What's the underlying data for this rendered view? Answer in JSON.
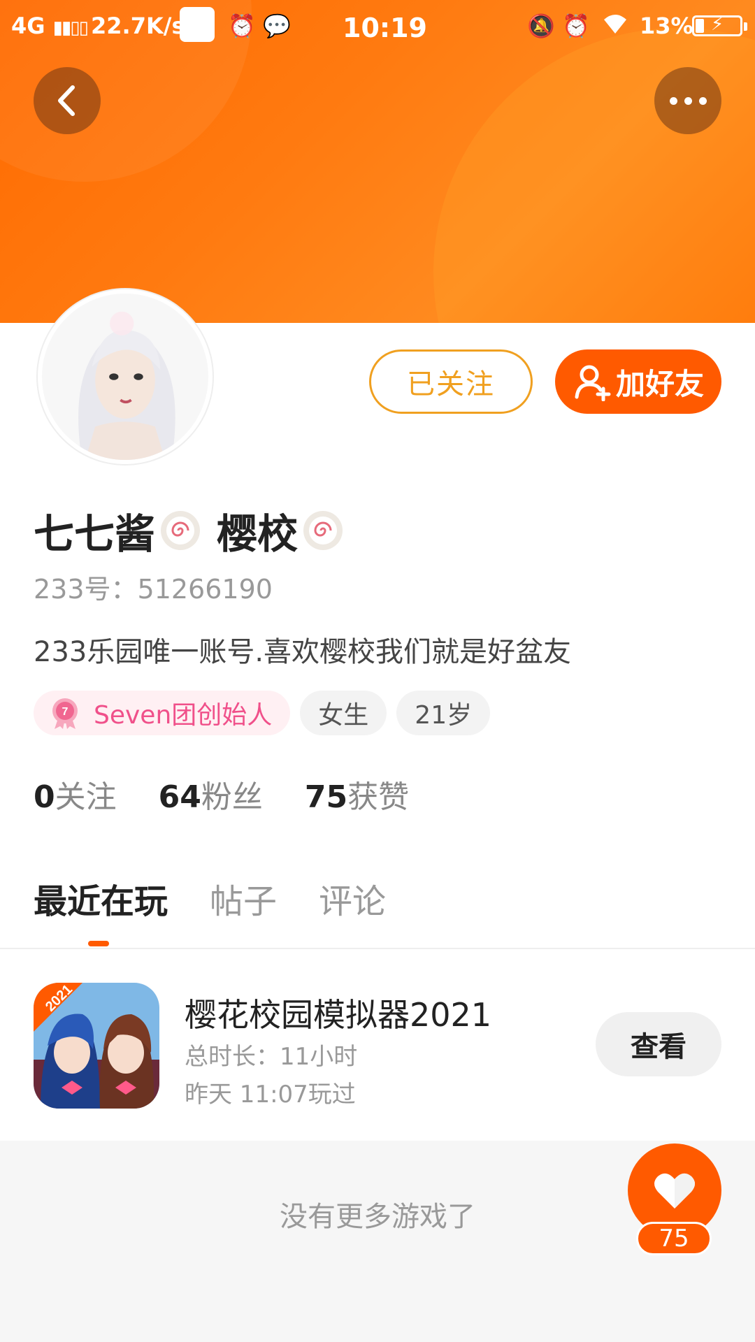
{
  "status_bar": {
    "network": "4G",
    "speed": "22.7K/s",
    "time": "10:19",
    "battery": "13%"
  },
  "header": {
    "back_icon": "chevron-left-icon",
    "more_icon": "more-dots-icon",
    "accent_color": "#ff6a00"
  },
  "profile": {
    "name_part1": "七七酱",
    "name_part2": "樱校",
    "user_id": "233号：51266190",
    "bio": "233乐园唯一账号.喜欢樱校我们就是好盆友",
    "followed_label": "已关注",
    "add_friend_label": "加好友",
    "tags": [
      {
        "label": "Seven团创始人",
        "badge": "7"
      },
      {
        "label": "女生"
      },
      {
        "label": "21岁"
      }
    ],
    "stats": {
      "following_num": "0",
      "following_label": "关注",
      "fans_num": "64",
      "fans_label": "粉丝",
      "likes_num": "75",
      "likes_label": "获赞"
    }
  },
  "tabs": [
    {
      "label": "最近在玩",
      "active": true
    },
    {
      "label": "帖子",
      "active": false
    },
    {
      "label": "评论",
      "active": false
    }
  ],
  "recent_games": [
    {
      "title": "樱花校园模拟器2021",
      "duration": "总时长：11小时",
      "last_played": "昨天 11:07玩过",
      "view_label": "查看",
      "icon_badge": "2021"
    }
  ],
  "footer": {
    "no_more": "没有更多游戏了",
    "like_count": "75"
  }
}
